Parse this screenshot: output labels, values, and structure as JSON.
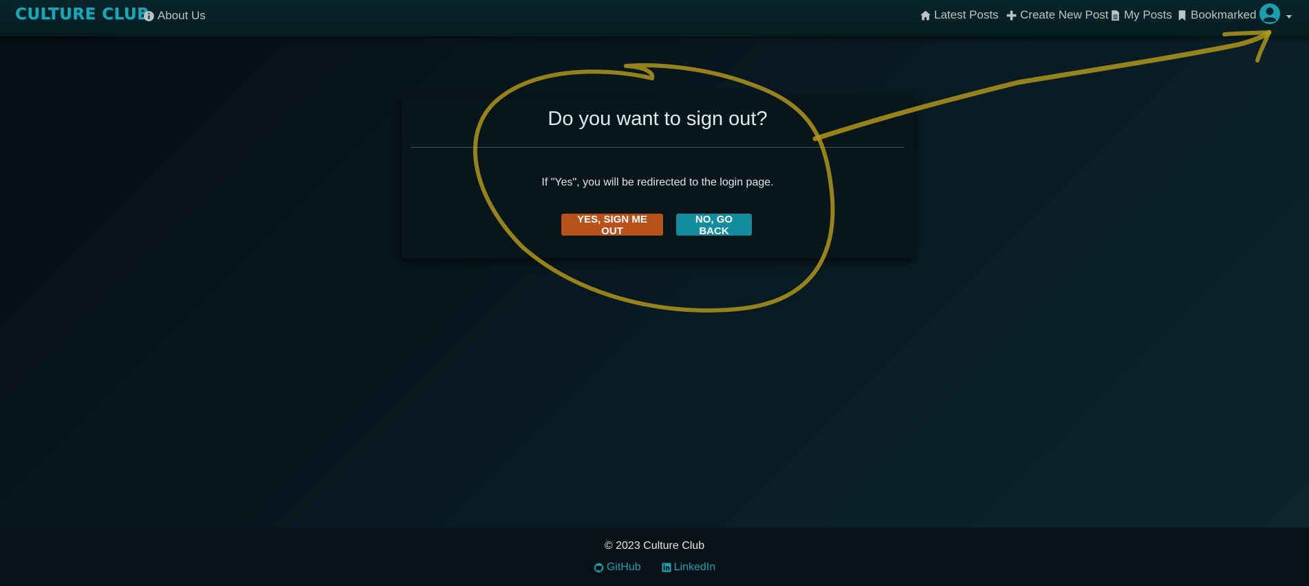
{
  "colors": {
    "brand": "#1aa7b8",
    "danger_button": "#b8521a",
    "info_button": "#138c9e",
    "annotation": "#b59a1c"
  },
  "navbar": {
    "brand": "CULTURE CLUB",
    "about_label": "About Us",
    "latest_label": "Latest Posts",
    "create_label": "Create New Post",
    "myposts_label": "My Posts",
    "bookmarked_label": "Bookmarked",
    "icons": {
      "about": "info-circle-icon",
      "latest": "home-icon",
      "create": "plus-icon",
      "myposts": "document-icon",
      "bookmarked": "bookmark-icon",
      "account": "user-circle-icon"
    }
  },
  "dialog": {
    "title": "Do you want to sign out?",
    "message": "If \"Yes\", you will be redirected to the login page.",
    "yes_label": "YES, SIGN ME OUT",
    "no_label": "NO, GO BACK"
  },
  "footer": {
    "copyright": "© 2023 Culture Club",
    "github_label": "GitHub",
    "linkedin_label": "LinkedIn"
  }
}
